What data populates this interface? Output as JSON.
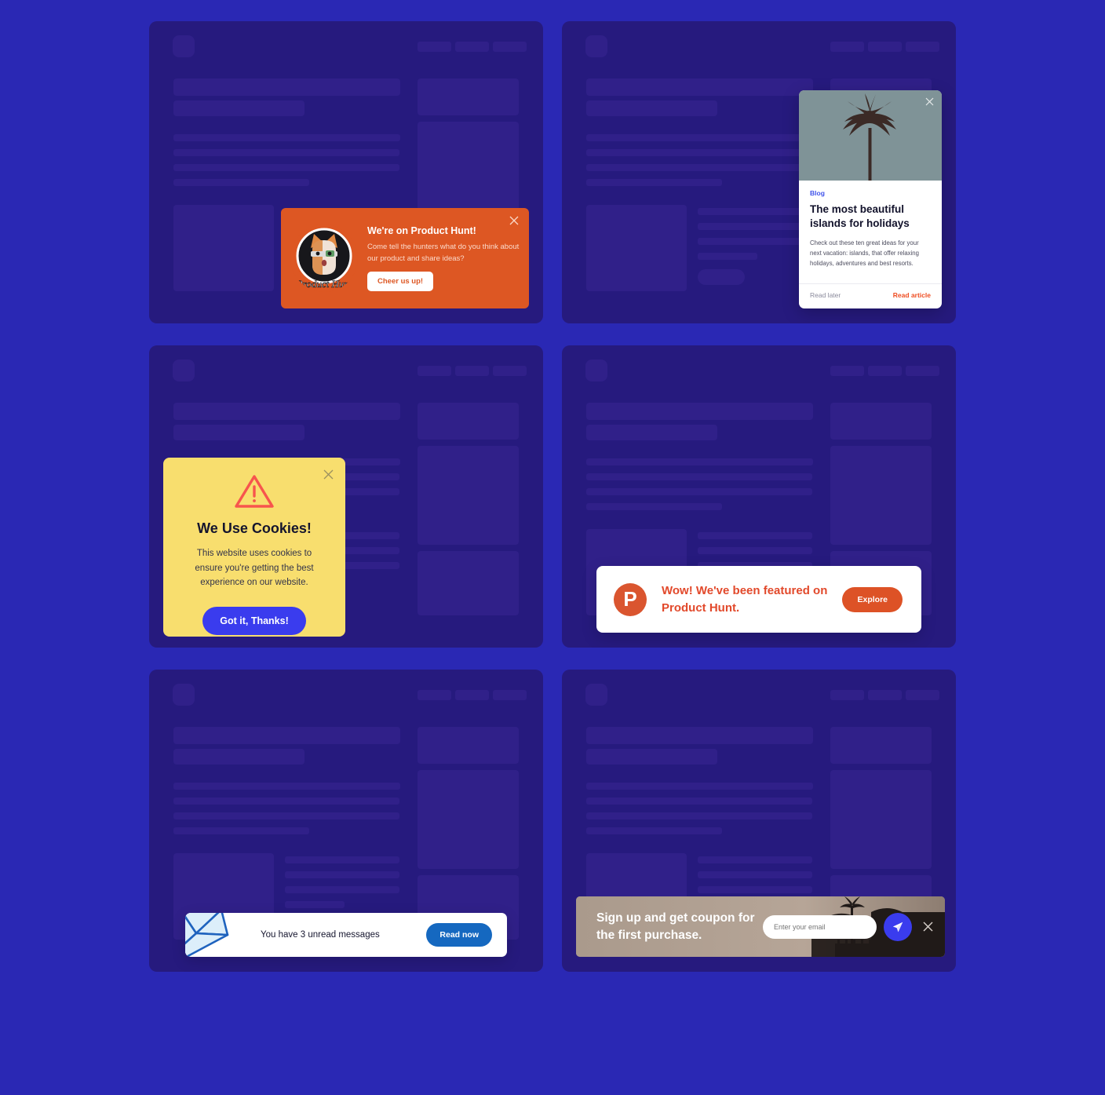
{
  "theme": {
    "page_bg": "#2A28B4",
    "card_bg": "#261A7E",
    "skeleton_bar": "#302089",
    "orange": "#DD5723",
    "orange_alt": "#E2492B",
    "blue_accent": "#3A3CEE",
    "blue_link": "#3F52EA",
    "yellow": "#F8DE6E",
    "msg_blue": "#1568C0",
    "white": "#FFFFFF"
  },
  "product_hunt_popup": {
    "title": "We're on Product Hunt!",
    "body": "Come tell the hunters what do you think about our product and share ideas?",
    "button_label": "Cheer us up!",
    "avatar_caption": "Product Hunt",
    "close_icon": "close-icon"
  },
  "blog_popup": {
    "tag": "Blog",
    "heading": "The most beautiful islands for holidays",
    "body": "Check out these ten great ideas for your next vacation: islands, that offer relaxing holidays, adventures and best resorts.",
    "secondary_action": "Read later",
    "primary_action": "Read article",
    "close_icon": "close-icon",
    "image_subject": "palm-tree-photo"
  },
  "cookies_popup": {
    "heading": "We Use Cookies!",
    "body": "This website uses cookies to ensure you're getting the best experience on our website.",
    "button_label": "Got it, Thanks!",
    "warning_icon": "warning-triangle-icon",
    "close_icon": "close-icon"
  },
  "featured_bar": {
    "logo_letter": "P",
    "logo_icon": "product-hunt-logo-icon",
    "text": "Wow! We've been featured on Product Hunt.",
    "button_label": "Explore"
  },
  "messages_bar": {
    "icon": "envelope-icon",
    "text": "You have 3 unread messages",
    "button_label": "Read now"
  },
  "coupon_bar": {
    "heading": "Sign up and get coupon for the first purchase.",
    "email_placeholder": "Enter your email",
    "email_value": "",
    "send_icon": "paper-plane-icon",
    "close_icon": "close-icon",
    "image_subject": "palm-silhouette-sunset-photo"
  }
}
